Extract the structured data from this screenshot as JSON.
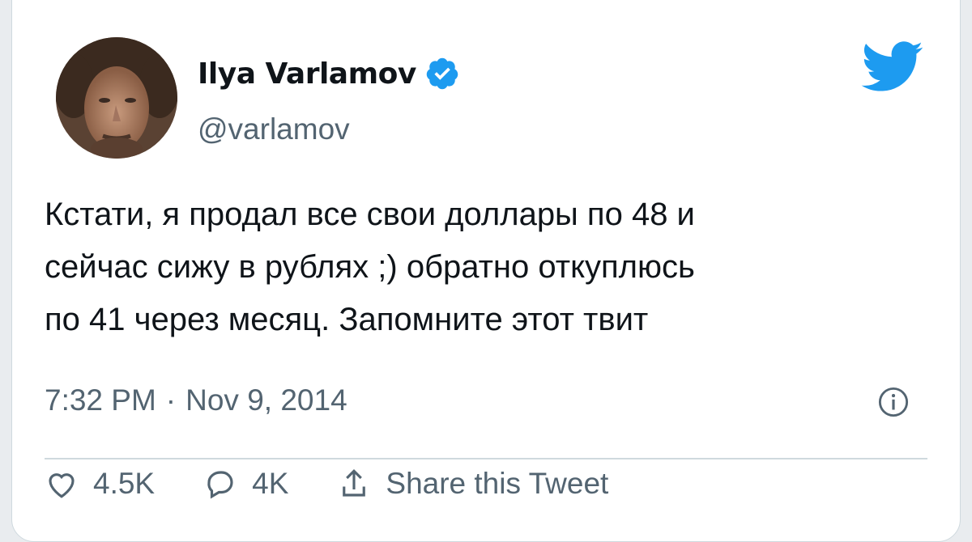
{
  "author": {
    "name": "Ilya Varlamov",
    "handle": "@varlamov",
    "verified": true
  },
  "tweet": {
    "lines": [
      "Кстати, я продал все свои доллары по 48 и",
      "сейчас сижу в рублях ;) обратно откуплюсь",
      "по 41 через месяц. Запомните этот твит"
    ],
    "time": "7:32 PM",
    "separator": "·",
    "date": "Nov 9, 2014"
  },
  "actions": {
    "like_count": "4.5K",
    "reply_count": "4K",
    "share_label": "Share this Tweet"
  },
  "colors": {
    "twitter_blue": "#1d9bf0",
    "text": "#0f1419",
    "secondary": "#536471"
  }
}
